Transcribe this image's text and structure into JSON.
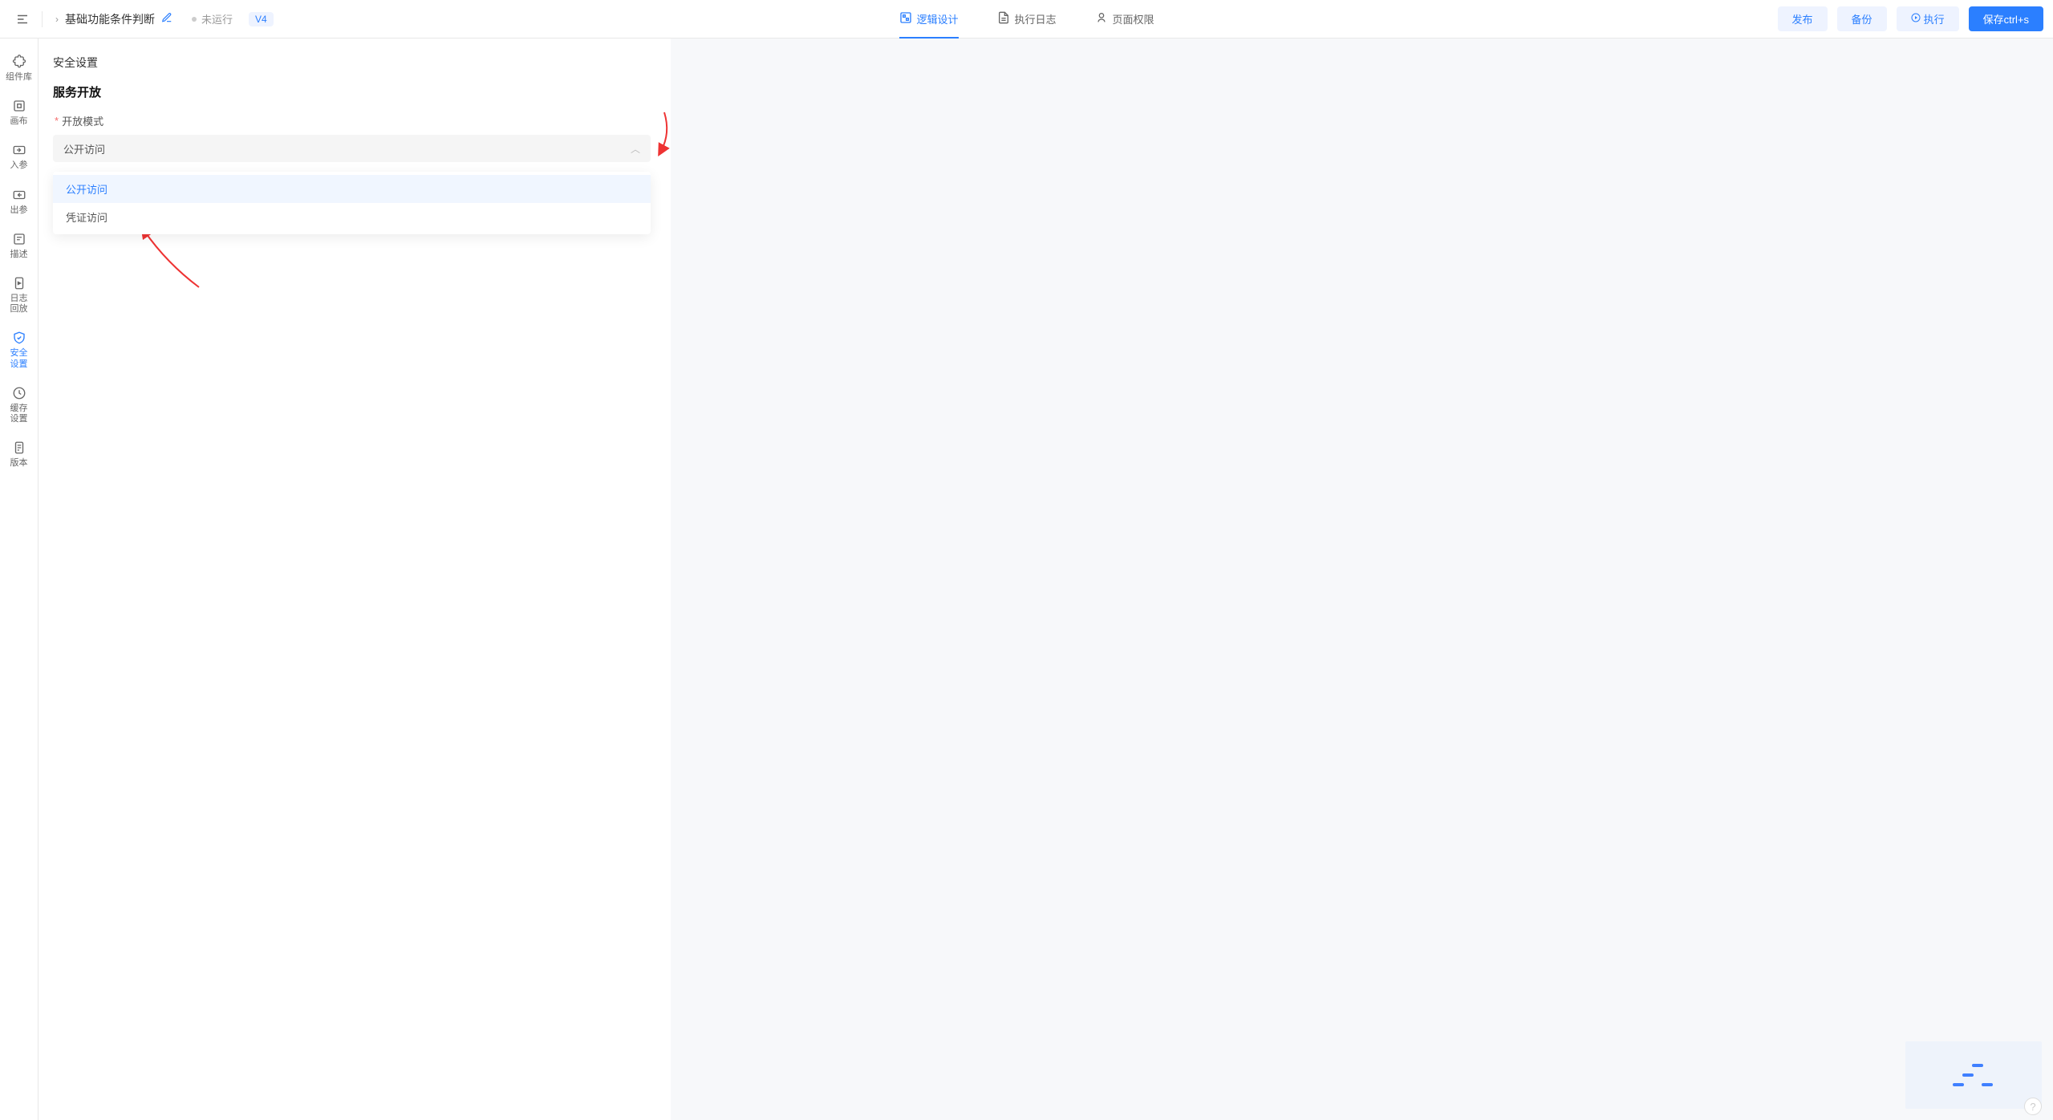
{
  "header": {
    "breadcrumb_title": "基础功能条件判断",
    "status_text": "未运行",
    "version_badge": "V4",
    "tabs": [
      {
        "label": "逻辑设计"
      },
      {
        "label": "执行日志"
      },
      {
        "label": "页面权限"
      }
    ],
    "buttons": {
      "publish": "发布",
      "backup": "备份",
      "execute": "执行",
      "save": "保存ctrl+s"
    }
  },
  "sidebar": {
    "items": [
      {
        "label": "组件库"
      },
      {
        "label": "画布"
      },
      {
        "label": "入参"
      },
      {
        "label": "出参"
      },
      {
        "label": "描述"
      },
      {
        "label": "日志\n回放"
      },
      {
        "label": "安全\n设置"
      },
      {
        "label": "缓存\n设置"
      },
      {
        "label": "版本"
      }
    ]
  },
  "main": {
    "section_title": "安全设置",
    "section_subtitle": "服务开放",
    "open_mode_label": "开放模式",
    "select_value": "公开访问",
    "dropdown_options": [
      {
        "label": "公开访问"
      },
      {
        "label": "凭证访问"
      }
    ]
  }
}
